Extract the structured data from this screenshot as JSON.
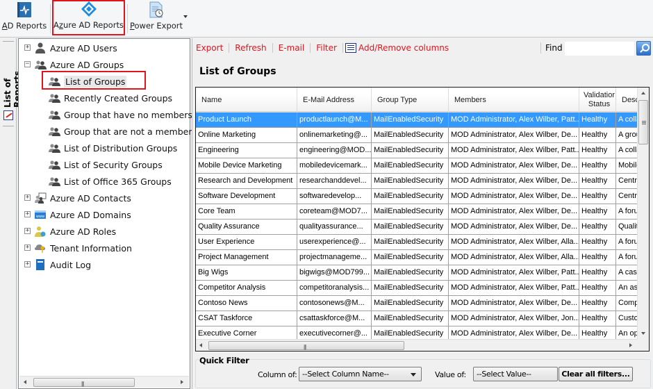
{
  "ribbon": {
    "buttons": [
      {
        "id": "ad-reports",
        "label": "AD Reports",
        "accesskey": "A",
        "rest": "D Reports",
        "icon": "ad-reports-book-icon"
      },
      {
        "id": "azure-ad-reports",
        "label": "Azure AD Reports",
        "pre": "A",
        "accesskey": "z",
        "rest": "ure AD Reports",
        "icon": "azure-diamond-icon",
        "highlighted": true
      },
      {
        "id": "power-export",
        "label": "Power Export",
        "accesskey": "P",
        "rest": "ower Export",
        "icon": "document-clock-icon"
      }
    ]
  },
  "side_tab": {
    "label": "List of Reports"
  },
  "tree": {
    "nodes": [
      {
        "label": "Azure AD Users",
        "level": 0,
        "expander": "+",
        "icon": "user-icon"
      },
      {
        "label": "Azure AD Groups",
        "level": 0,
        "expander": "−",
        "icon": "group-icon"
      },
      {
        "label": "List of Groups",
        "level": 1,
        "icon": "group-icon",
        "selected": true
      },
      {
        "label": "Recently Created Groups",
        "level": 1,
        "icon": "group-icon"
      },
      {
        "label": "Group that have no members",
        "level": 1,
        "icon": "group-icon"
      },
      {
        "label": "Group that are not a member of",
        "level": 1,
        "icon": "group-icon"
      },
      {
        "label": "List of Distribution Groups",
        "level": 1,
        "icon": "group-icon"
      },
      {
        "label": "List of Security Groups",
        "level": 1,
        "icon": "group-icon"
      },
      {
        "label": "List of Office 365 Groups",
        "level": 1,
        "icon": "group-icon"
      },
      {
        "label": "Azure AD Contacts",
        "level": 0,
        "expander": "+",
        "icon": "contacts-icon"
      },
      {
        "label": "Azure AD Domains",
        "level": 0,
        "expander": "+",
        "icon": "domain-www-icon"
      },
      {
        "label": "Azure AD Roles",
        "level": 0,
        "expander": "+",
        "icon": "roles-icon"
      },
      {
        "label": "Tenant Information",
        "level": 0,
        "expander": "+",
        "icon": "cloud-key-icon"
      },
      {
        "label": "Audit Log",
        "level": 0,
        "expander": "+",
        "icon": "audit-book-icon"
      }
    ]
  },
  "commands": {
    "export": "Export",
    "refresh": "Refresh",
    "email": "E-mail",
    "filter": "Filter",
    "add_remove_columns": "Add/Remove columns",
    "find_label": "Find",
    "find_value": ""
  },
  "report": {
    "title": "List of Groups",
    "columns": [
      "Name",
      "E-Mail Address",
      "Group Type",
      "Members",
      "Validation Status",
      "Description"
    ],
    "columns_visible": [
      "Name",
      "E-Mail Address",
      "Group Type",
      "Members",
      "Validatior Status",
      "Desc"
    ],
    "selected_row": 0,
    "rows": [
      [
        "Product Launch",
        "productlaunch@M...",
        "MailEnabledSecurity",
        "MOD Administrator, Alex Wilber, Patt...",
        "Healthy",
        "A colla"
      ],
      [
        "Online Marketing",
        "onlinemarketing@...",
        "MailEnabledSecurity",
        "MOD Administrator, Alex Wilber, De...",
        "Healthy",
        "A grou"
      ],
      [
        "Engineering",
        "engineering@MOD...",
        "MailEnabledSecurity",
        "MOD Administrator, Alex Wilber, Patt...",
        "Healthy",
        "A colla"
      ],
      [
        "Mobile Device Marketing",
        "mobiledevicemark...",
        "MailEnabledSecurity",
        "MOD Administrator, Alex Wilber, De...",
        "Healthy",
        "Mobile"
      ],
      [
        "Research and Development",
        "researchanddevel...",
        "MailEnabledSecurity",
        "MOD Administrator, Alex Wilber, De...",
        "Healthy",
        "Centra"
      ],
      [
        "Software Development",
        "softwaredevelop...",
        "MailEnabledSecurity",
        "MOD Administrator, Alex Wilber, De...",
        "Healthy",
        "Centra"
      ],
      [
        "Core Team",
        "coreteam@MOD7...",
        "MailEnabledSecurity",
        "MOD Administrator, Alex Wilber, De...",
        "Healthy",
        "A foru"
      ],
      [
        "Quality Assurance",
        "qualityassurance...",
        "MailEnabledSecurity",
        "MOD Administrator, Alex Wilber, De...",
        "Healthy",
        "Quality"
      ],
      [
        "User Experience",
        "userexperience@...",
        "MailEnabledSecurity",
        "MOD Administrator, Alex Wilber, Alla...",
        "Healthy",
        "A foru"
      ],
      [
        "Project Management",
        "projectmanageme...",
        "MailEnabledSecurity",
        "MOD Administrator, Alex Wilber, Alla...",
        "Healthy",
        "A foru"
      ],
      [
        "Big Wigs",
        "bigwigs@MOD799...",
        "MailEnabledSecurity",
        "MOD Administrator, Alex Wilber, Patt...",
        "Healthy",
        "A cas"
      ],
      [
        "Competitor Analysis",
        "competitoranalysis...",
        "MailEnabledSecurity",
        "MOD Administrator, Alex Wilber, Patt...",
        "Healthy",
        "An as"
      ],
      [
        "Contoso News",
        "contosonews@M...",
        "MailEnabledSecurity",
        "MOD Administrator, Alex Wilber, De...",
        "Healthy",
        "Comp"
      ],
      [
        "CSAT Taskforce",
        "csattaskforce@M...",
        "MailEnabledSecurity",
        "MOD Administrator, Alex Wilber, Jon...",
        "Healthy",
        "Custo"
      ],
      [
        "Executive Corner",
        "executivecorner@...",
        "MailEnabledSecurity",
        "MOD Administrator, Alex Wilber, De...",
        "Healthy",
        "An op"
      ]
    ]
  },
  "quick_filter": {
    "title": "Quick Filter",
    "column_label": "Column of:",
    "column_value": "--Select Column Name--",
    "value_label": "Value of:",
    "value_value": "--Select Value--",
    "clear_button": "Clear all filters..."
  },
  "colors": {
    "accent_red": "#e0141e",
    "selection_blue": "#3399ff"
  }
}
